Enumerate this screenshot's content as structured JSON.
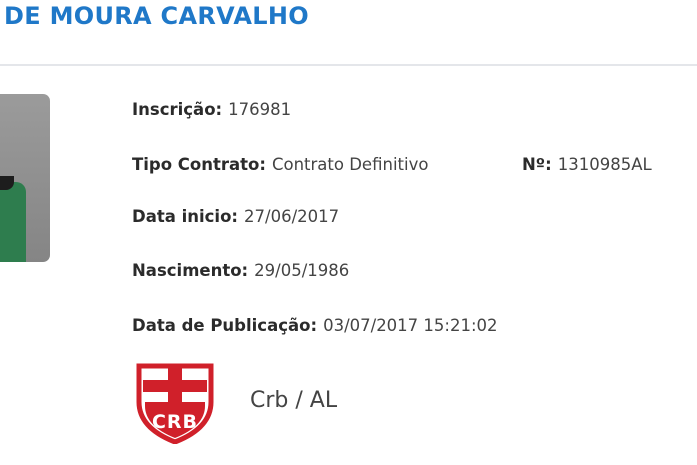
{
  "header": {
    "name": "DE MOURA CARVALHO"
  },
  "colors": {
    "title": "#1f78c8",
    "label": "#2b2b2b",
    "value": "#444444",
    "crest_red": "#d0202a"
  },
  "fields": {
    "inscricao": {
      "label": "Inscrição:",
      "value": "176981"
    },
    "tipo_contrato": {
      "label": "Tipo Contrato:",
      "value": "Contrato Definitivo"
    },
    "numero": {
      "label": "Nº:",
      "value": "1310985AL"
    },
    "data_inicio": {
      "label": "Data inicio:",
      "value": "27/06/2017"
    },
    "nascimento": {
      "label": "Nascimento:",
      "value": "29/05/1986"
    },
    "data_publicacao": {
      "label": "Data de Publicação:",
      "value": "03/07/2017 15:21:02"
    }
  },
  "club": {
    "crest_text": "CRB",
    "name": "Crb / AL"
  },
  "icons": {
    "photo": "athlete-photo",
    "crest": "club-crest-icon"
  }
}
